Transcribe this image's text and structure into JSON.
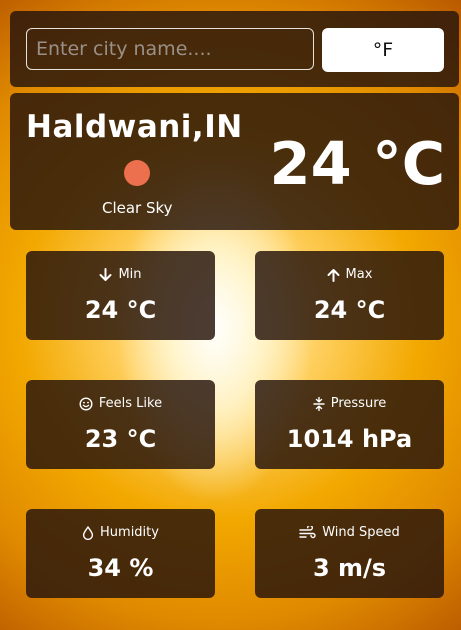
{
  "search": {
    "placeholder": "Enter city name....",
    "value": ""
  },
  "unit_toggle": {
    "label": "°F"
  },
  "current": {
    "city": "Haldwani,IN",
    "condition": "Clear Sky",
    "temperature": "24 °C",
    "icon": "sun-icon",
    "icon_color": "#ec6f4e"
  },
  "stats": {
    "min": {
      "label": "Min",
      "value": "24 °C",
      "icon": "arrow-down-icon"
    },
    "max": {
      "label": "Max",
      "value": "24 °C",
      "icon": "arrow-up-icon"
    },
    "feels_like": {
      "label": "Feels Like",
      "value": "23 °C",
      "icon": "smiley-icon"
    },
    "pressure": {
      "label": "Pressure",
      "value": "1014 hPa",
      "icon": "pressure-icon"
    },
    "humidity": {
      "label": "Humidity",
      "value": "34 %",
      "icon": "droplet-icon"
    },
    "wind_speed": {
      "label": "Wind Speed",
      "value": "3 m/s",
      "icon": "wind-icon"
    }
  }
}
